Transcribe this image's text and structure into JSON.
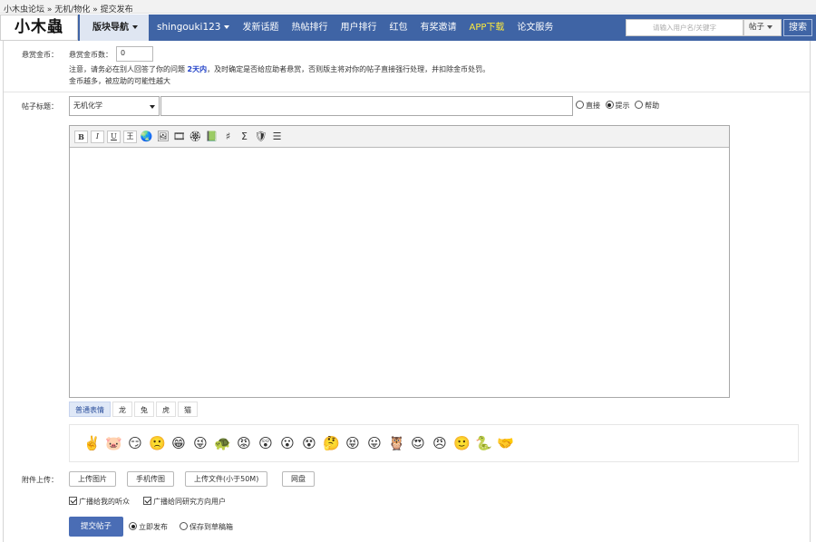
{
  "breadcrumb": [
    "小木虫论坛",
    "无机/物化",
    "提交发布"
  ],
  "breadcrumb_sep": "»",
  "nav": {
    "logo": "小木蟲",
    "board_nav": "版块导航",
    "links": [
      {
        "label": "shingouki123",
        "kind": "user"
      },
      {
        "label": "发新话题",
        "kind": "link"
      },
      {
        "label": "热帖排行",
        "kind": "link"
      },
      {
        "label": "用户排行",
        "kind": "link"
      },
      {
        "label": "红包",
        "kind": "link"
      },
      {
        "label": "有奖邀请",
        "kind": "link"
      },
      {
        "label": "APP下载",
        "kind": "app"
      },
      {
        "label": "论文服务",
        "kind": "link"
      }
    ],
    "search_placeholder": "请输入用户名/关键字",
    "search_scope": "帖子",
    "search_button": "搜索"
  },
  "reward": {
    "label": "悬赏金币：",
    "count_label": "悬赏金币数：",
    "count_value": "0",
    "note_prefix": "注意，请务必在别人回答了你的问题 ",
    "note_highlight": "2天内",
    "note_suffix": "，及时确定是否给应助者悬赏，否则版主将对你的帖子直接强行处理，并扣除金币处罚。",
    "note2": "金币越多，被应助的可能性越大"
  },
  "title_row": {
    "label": "帖子标题：",
    "category": "无机化学",
    "title_value": "",
    "modes": [
      {
        "label": "直接",
        "checked": false
      },
      {
        "label": "提示",
        "checked": true
      },
      {
        "label": "帮助",
        "checked": false
      }
    ]
  },
  "toolbar": {
    "bold": "B",
    "italic": "I",
    "underline": "U",
    "strike": "王"
  },
  "emoticons": {
    "tabs": [
      {
        "label": "普通表情",
        "active": true
      },
      {
        "label": "龙",
        "active": false
      },
      {
        "label": "兔",
        "active": false
      },
      {
        "label": "虎",
        "active": false
      },
      {
        "label": "猫",
        "active": false
      }
    ],
    "items": [
      "✌️",
      "🐷",
      "😏",
      "🙁",
      "😁",
      "😜",
      "🐢",
      "😡",
      "😲",
      "😮",
      "😵",
      "🤔",
      "😝",
      "😛",
      "🦉",
      "😍",
      "😠",
      "🙂",
      "🐍",
      "🤝"
    ]
  },
  "attach": {
    "label": "附件上传：",
    "buttons": [
      "上传图片",
      "手机传图",
      "上传文件(小于50M)",
      "网盘"
    ],
    "broadcast1": "广播给我的听众",
    "broadcast2": "广播给同研究方向用户"
  },
  "submit": {
    "button": "提交帖子",
    "publish_now": "立即发布",
    "save_draft": "保存到草稿箱"
  }
}
